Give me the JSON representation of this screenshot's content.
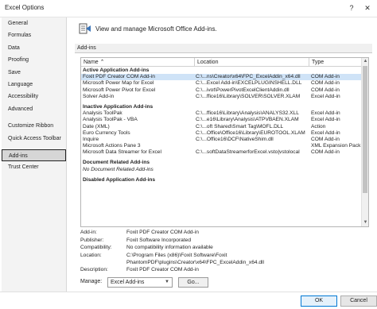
{
  "window": {
    "title": "Excel Options",
    "help_glyph": "?",
    "close_glyph": "✕"
  },
  "sidebar": {
    "items": [
      {
        "label": "General"
      },
      {
        "label": "Formulas"
      },
      {
        "label": "Data"
      },
      {
        "label": "Proofing"
      },
      {
        "label": "Save"
      },
      {
        "label": "Language"
      },
      {
        "label": "Accessibility"
      },
      {
        "label": "Advanced"
      },
      {
        "label": "Customize Ribbon"
      },
      {
        "label": "Quick Access Toolbar"
      },
      {
        "label": "Add-ins"
      },
      {
        "label": "Trust Center"
      }
    ],
    "selected": "Add-ins"
  },
  "main": {
    "header": "View and manage Microsoft Office Add-ins.",
    "section_title": "Add-ins",
    "columns": {
      "name": "Name ⌃",
      "location": "Location",
      "type": "Type"
    },
    "groups": [
      {
        "title": "Active Application Add-ins",
        "rows": [
          {
            "name": "Foxit PDF Creator COM Add-in",
            "location": "C:\\...ns\\Creator\\x64\\FPC_ExcelAddin_x64.dll",
            "type": "COM Add-in"
          },
          {
            "name": "Microsoft Power Map for Excel",
            "location": "C:\\...Excel Add-in\\EXCELPLUGINSHELL.DLL",
            "type": "COM Add-in"
          },
          {
            "name": "Microsoft Power Pivot for Excel",
            "location": "C:\\...ivot\\PowerPivotExcelClientAddin.dll",
            "type": "COM Add-in"
          },
          {
            "name": "Solver Add-in",
            "location": "C:\\...ffice16\\Library\\SOLVER\\SOLVER.XLAM",
            "type": "Excel Add-in"
          }
        ]
      },
      {
        "title": "Inactive Application Add-ins",
        "rows": [
          {
            "name": "Analysis ToolPak",
            "location": "C:\\...ffice16\\Library\\Analysis\\ANALYS32.XLL",
            "type": "Excel Add-in"
          },
          {
            "name": "Analysis ToolPak - VBA",
            "location": "C:\\...e16\\Library\\Analysis\\ATPVBAEN.XLAM",
            "type": "Excel Add-in"
          },
          {
            "name": "Date (XML)",
            "location": "C:\\...oft Shared\\Smart Tag\\MOFL.DLL",
            "type": "Action"
          },
          {
            "name": "Euro Currency Tools",
            "location": "C:\\...Office\\Office16\\Library\\EUROTOOL.XLAM",
            "type": "Excel Add-in"
          },
          {
            "name": "Inquire",
            "location": "C:\\...Office16\\DCF\\NativeShim.dll",
            "type": "COM Add-in"
          },
          {
            "name": "Microsoft Actions Pane 3",
            "location": "",
            "type": "XML Expansion Pack"
          },
          {
            "name": "Microsoft Data Streamer for Excel",
            "location": "C:\\...softDataStreamerforExcel.vsto|vstolocal",
            "type": "COM Add-in"
          }
        ]
      },
      {
        "title": "Document Related Add-ins",
        "rows": [
          {
            "name": "No Document Related Add-ins",
            "location": "",
            "type": "",
            "empty": true
          }
        ]
      },
      {
        "title": "Disabled Application Add-ins",
        "rows": []
      }
    ],
    "selected_row": "Foxit PDF Creator COM Add-in",
    "details": [
      {
        "label": "Add-in:",
        "value": "Foxit PDF Creator COM Add-in"
      },
      {
        "label": "Publisher:",
        "value": "Foxit Software Incorporated"
      },
      {
        "label": "Compatibility:",
        "value": "No compatibility information available"
      },
      {
        "label": "Location:",
        "value": "C:\\Program Files (x86)\\Foxit Software\\Foxit PhantomPDF\\plugins\\Creator\\x64\\FPC_ExcelAddin_x64.dll"
      },
      {
        "label": "Description:",
        "value": "Foxit PDF Creator COM Add-in"
      }
    ],
    "manage": {
      "label": "Manage:",
      "selected": "Excel Add-ins",
      "go_label": "Go..."
    }
  },
  "footer": {
    "ok_label": "OK",
    "cancel_label": "Cancel"
  }
}
